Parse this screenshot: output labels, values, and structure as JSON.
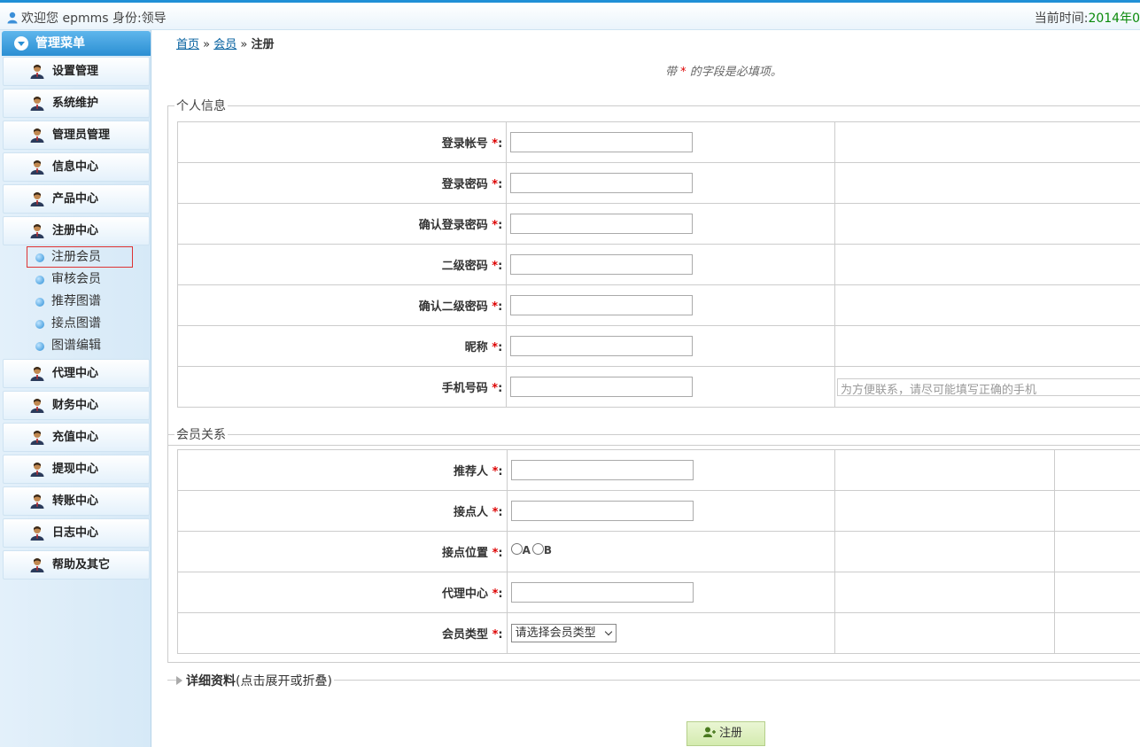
{
  "topbar": {
    "welcome": "欢迎您 epmms 身份:领导",
    "time_label": "当前时间:",
    "time_value": "2014年0"
  },
  "sidebar": {
    "header": "管理菜单",
    "items": [
      {
        "label": "设置管理"
      },
      {
        "label": "系统维护"
      },
      {
        "label": "管理员管理"
      },
      {
        "label": "信息中心"
      },
      {
        "label": "产品中心"
      },
      {
        "label": "注册中心"
      },
      {
        "label": "代理中心"
      },
      {
        "label": "财务中心"
      },
      {
        "label": "充值中心"
      },
      {
        "label": "提现中心"
      },
      {
        "label": "转账中心"
      },
      {
        "label": "日志中心"
      },
      {
        "label": "帮助及其它"
      }
    ],
    "subitems": [
      {
        "label": "注册会员"
      },
      {
        "label": "审核会员"
      },
      {
        "label": "推荐图谱"
      },
      {
        "label": "接点图谱"
      },
      {
        "label": "图谱编辑"
      }
    ]
  },
  "breadcrumb": {
    "home": "首页",
    "member": "会员",
    "sep": "»",
    "current": "注册"
  },
  "required_note": {
    "prefix": "带",
    "star": "*",
    "suffix": " 的字段是必填项。"
  },
  "personal": {
    "legend": "个人信息",
    "fields": [
      {
        "label": "登录帐号",
        "value": ""
      },
      {
        "label": "登录密码",
        "value": ""
      },
      {
        "label": "确认登录密码",
        "value": ""
      },
      {
        "label": "二级密码",
        "value": ""
      },
      {
        "label": "确认二级密码",
        "value": ""
      },
      {
        "label": "昵称",
        "value": ""
      },
      {
        "label": "手机号码",
        "value": ""
      }
    ],
    "phone_hint": "为方便联系，请尽可能填写正确的手机"
  },
  "relation": {
    "legend": "会员关系",
    "fields": [
      {
        "label": "推荐人",
        "value": ""
      },
      {
        "label": "接点人",
        "value": ""
      },
      {
        "label": "接点位置"
      },
      {
        "label": "代理中心",
        "value": ""
      },
      {
        "label": "会员类型"
      }
    ],
    "position_options": [
      "A",
      "B"
    ],
    "member_type_selected": "请选择会员类型"
  },
  "field_suffix": "*",
  "field_colon": ":",
  "detail": {
    "label": "详细资料",
    "hint": "(点击展开或折叠)"
  },
  "register_button": "注册",
  "colors": {
    "accent": "#1f8fd6",
    "required": "#dd0000",
    "time": "#0a8a0a",
    "button_bg": "#d4ebaf"
  }
}
